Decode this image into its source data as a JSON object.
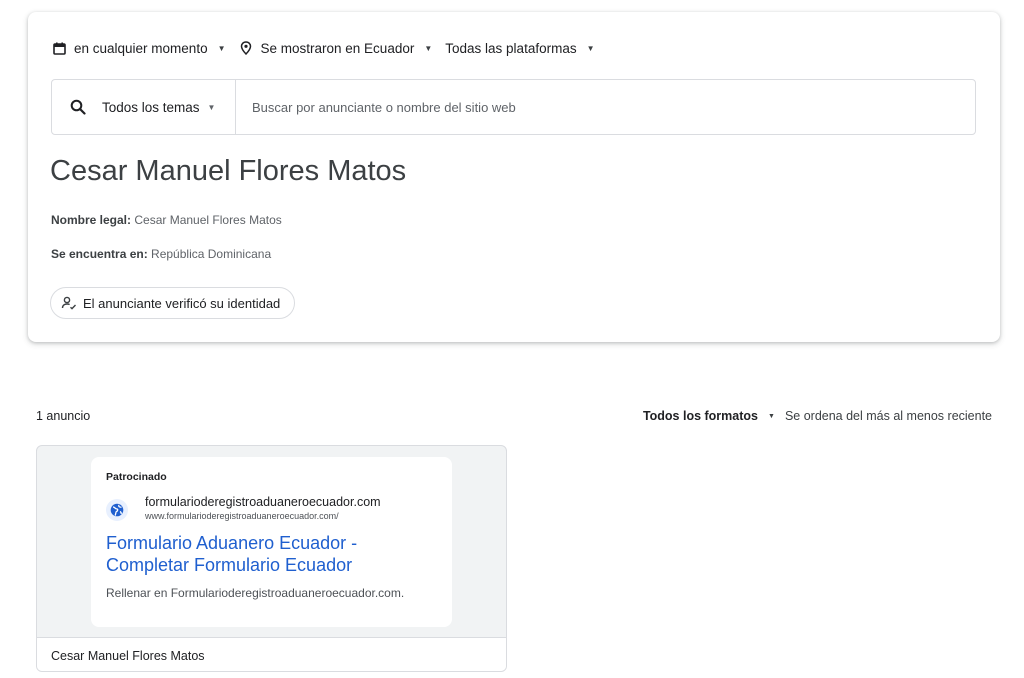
{
  "filters": {
    "date": "en cualquier momento",
    "region": "Se mostraron en Ecuador",
    "platform": "Todas las plataformas"
  },
  "search": {
    "topic": "Todos los temas",
    "placeholder": "Buscar por anunciante o nombre del sitio web"
  },
  "advertiser": {
    "name": "Cesar Manuel Flores Matos",
    "legal_label": "Nombre legal:",
    "legal_value": "Cesar Manuel Flores Matos",
    "location_label": "Se encuentra en:",
    "location_value": "República Dominicana",
    "verified": "El anunciante verificó su identidad"
  },
  "results": {
    "count": "1 anuncio",
    "format": "Todos los formatos",
    "order": "Se ordena del más al menos reciente"
  },
  "ad": {
    "sponsored": "Patrocinado",
    "site_name": "formularioderegistroaduaneroecuador.com",
    "site_url": "www.formularioderegistroaduaneroecuador.com/",
    "title_line1": "Formulario Aduanero Ecuador -",
    "title_line2": "Completar Formulario Ecuador",
    "description": "Rellenar en Formularioderegistroaduaneroecuador.com.",
    "advertiser": "Cesar Manuel Flores Matos"
  },
  "colors": {
    "link": "#1f5fcf",
    "border": "#dadce0",
    "card_bg": "#f1f3f4"
  }
}
